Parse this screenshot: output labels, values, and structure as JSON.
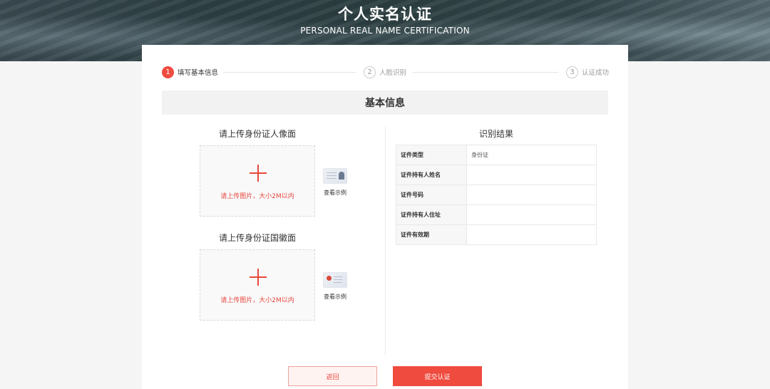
{
  "banner": {
    "title": "个人实名认证",
    "subtitle": "PERSONAL REAL NAME CERTIFICATION"
  },
  "steps": [
    {
      "number": "1",
      "label": "填写基本信息",
      "active": true
    },
    {
      "number": "2",
      "label": "人脸识别",
      "active": false
    },
    {
      "number": "3",
      "label": "认证成功",
      "active": false
    }
  ],
  "section": {
    "title": "基本信息"
  },
  "uploads": {
    "front": {
      "title": "请上传身份证人像面",
      "hint": "请上传图片，大小2M以内",
      "sample_label": "查看示例"
    },
    "back": {
      "title": "请上传身份证国徽面",
      "hint": "请上传图片，大小2M以内",
      "sample_label": "查看示例"
    }
  },
  "result": {
    "title": "识别结果",
    "rows": [
      {
        "label": "证件类型",
        "value": "身份证"
      },
      {
        "label": "证件持有人姓名",
        "value": ""
      },
      {
        "label": "证件号码",
        "value": ""
      },
      {
        "label": "证件持有人住址",
        "value": ""
      },
      {
        "label": "证件有效期",
        "value": ""
      }
    ]
  },
  "buttons": {
    "back": "返回",
    "submit": "提交认证"
  },
  "colors": {
    "accent": "#ef4b3f",
    "banner": "#2d3f44"
  },
  "icons": [
    "plus-icon",
    "id-card-front-icon",
    "id-card-back-icon"
  ]
}
